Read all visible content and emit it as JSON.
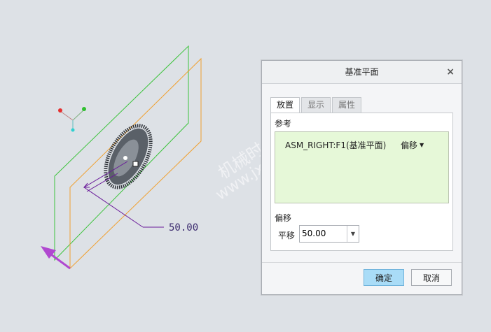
{
  "viewport": {
    "dimension_value": "50.00"
  },
  "watermark": {
    "line1": "机械时代网",
    "line2": "www.jxage.com"
  },
  "dialog": {
    "title": "基准平面",
    "close_icon": "close-icon",
    "tabs": [
      {
        "label": "放置",
        "active": true
      },
      {
        "label": "显示",
        "active": false
      },
      {
        "label": "属性",
        "active": false
      }
    ],
    "references_label": "参考",
    "reference": {
      "name": "ASM_RIGHT:F1(基准平面)",
      "constraint": "偏移"
    },
    "offset_section_label": "偏移",
    "offset_field_label": "平移",
    "offset_value": "50.00",
    "ok_label": "确定",
    "cancel_label": "取消"
  },
  "colors": {
    "accent_button": "#a9dcf7",
    "reference_bg": "#e6f8d8",
    "plane_green": "#3cc33c",
    "plane_orange": "#f0a030",
    "dimension_purple": "#6a1b9a",
    "arrow_magenta": "#b048d0"
  }
}
